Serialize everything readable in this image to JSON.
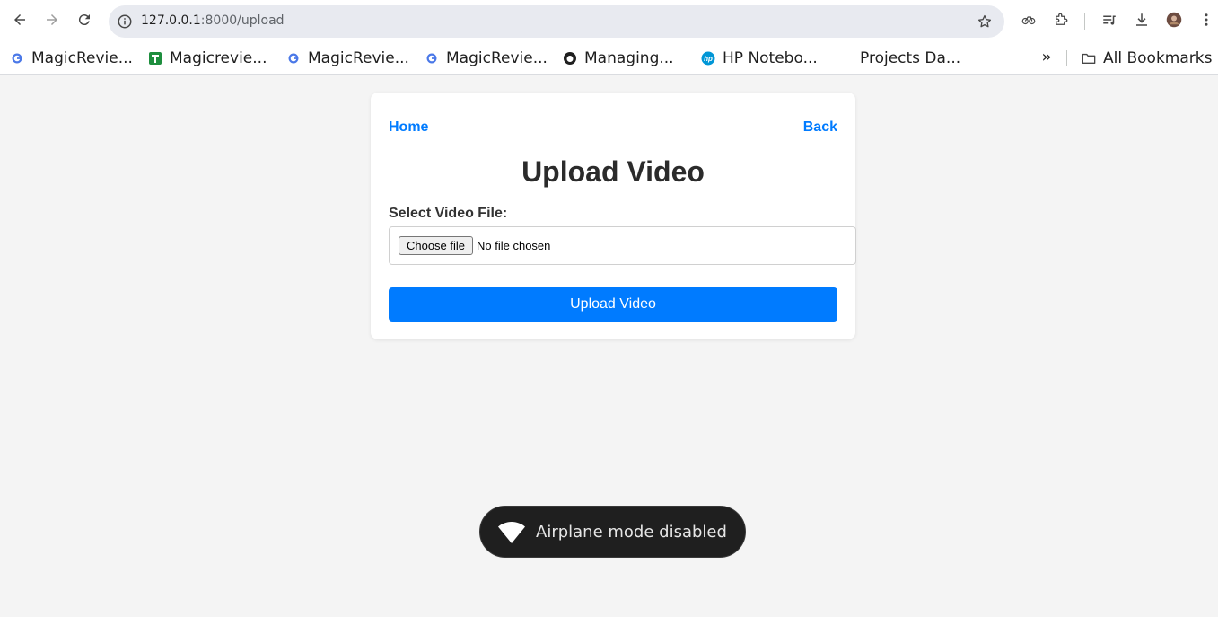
{
  "browser": {
    "url_host": "127.0.0.1",
    "url_rest": ":8000/upload",
    "bookmarks": [
      {
        "label": "MagicRevie...",
        "icon": "g-icon"
      },
      {
        "label": "Magicrevie...",
        "icon": "sheets-icon"
      },
      {
        "label": "MagicRevie...",
        "icon": "g-icon"
      },
      {
        "label": "MagicRevie...",
        "icon": "g-icon"
      },
      {
        "label": "Managing...",
        "icon": "github-icon"
      },
      {
        "label": "HP Notebo...",
        "icon": "hp-icon"
      },
      {
        "label": "Projects Da...",
        "icon": ""
      }
    ],
    "more_label": "»",
    "all_bookmarks": "All Bookmarks"
  },
  "page": {
    "home_link": "Home",
    "back_link": "Back",
    "title": "Upload Video",
    "field_label": "Select Video File:",
    "choose_file": "Choose file",
    "no_file": "No file chosen",
    "submit": "Upload Video"
  },
  "toast": {
    "message": "Airplane mode disabled"
  },
  "colors": {
    "accent": "#007bff",
    "background": "#f4f4f4",
    "toast_bg": "#1f1f1f"
  }
}
